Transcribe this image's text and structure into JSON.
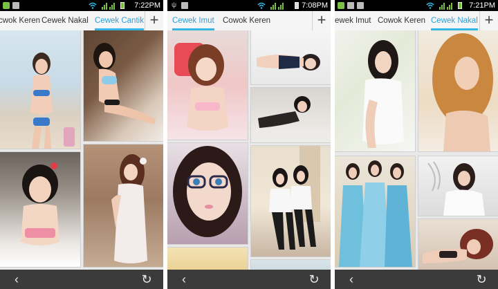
{
  "phones": [
    {
      "status_time": "7:22PM",
      "tabs": [
        "cwok Keren",
        "Cewek Nakal",
        "Cewek Cantik"
      ],
      "active_tab": 2,
      "plus_label": "+",
      "tiles": [
        "photo-woman-bikini-beach",
        "photo-woman-blue-bikini-seated",
        "photo-girl-pink-top-bed",
        "photo-woman-white-dress"
      ]
    },
    {
      "status_time": "7:08PM",
      "tabs": [
        "Cewek Imut",
        "Cowok Keren"
      ],
      "active_tab": 0,
      "plus_label": "+",
      "tiles": [
        "photo-girl-pink-lingerie",
        "photo-woman-lying-sailor-top",
        "photo-girl-glasses-closeup",
        "photo-woman-lying-black-dress",
        "photo-two-women-sitting",
        "photo-partial-bottom-tile"
      ]
    },
    {
      "status_time": "7:21PM",
      "tabs": [
        "ewek Imut",
        "Cowok Keren",
        "Cewek Nakal"
      ],
      "active_tab": 2,
      "plus_label": "+",
      "tiles": [
        "photo-woman-white-shirt",
        "photo-woman-golden-hair",
        "photo-three-women-blue-dresses",
        "photo-woman-feather-dress",
        "photo-woman-lying-curly-hair"
      ]
    }
  ],
  "nav": {
    "back_icon": "‹",
    "reload_icon": "↻"
  }
}
